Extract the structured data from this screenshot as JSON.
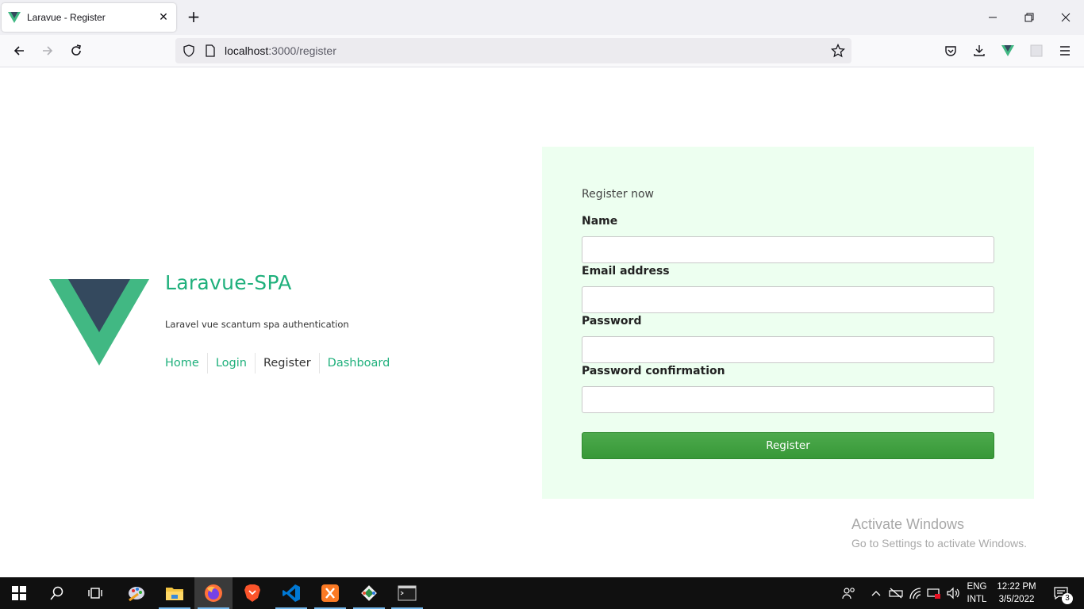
{
  "browser": {
    "tab_title": "Laravue - Register",
    "url_host": "localhost",
    "url_path": ":3000/register"
  },
  "brand": {
    "title": "Laravue-SPA",
    "subtitle": "Laravel vue scantum spa authentication",
    "colors": {
      "accent": "#1fb07c",
      "logo_light": "#41b883",
      "logo_dark": "#34495e"
    }
  },
  "menu": [
    {
      "label": "Home"
    },
    {
      "label": "Login"
    },
    {
      "label": "Register",
      "active": true
    },
    {
      "label": "Dashboard"
    }
  ],
  "form": {
    "heading": "Register now",
    "fields": [
      {
        "label": "Name",
        "value": ""
      },
      {
        "label": "Email address",
        "value": ""
      },
      {
        "label": "Password",
        "value": ""
      },
      {
        "label": "Password confirmation",
        "value": ""
      }
    ],
    "submit_label": "Register",
    "panel_color": "#edfff0",
    "button_color": "#3fa23f"
  },
  "watermark": {
    "title": "Activate Windows",
    "subtitle": "Go to Settings to activate Windows."
  },
  "taskbar": {
    "apps": [
      "start-icon",
      "search-icon",
      "task-view-icon",
      "paint-icon",
      "file-explorer-icon",
      "firefox-icon",
      "brave-icon",
      "vscode-icon",
      "xampp-icon",
      "git-icon",
      "terminal-icon"
    ],
    "lang_top": "ENG",
    "lang_bottom": "INTL",
    "time": "12:22 PM",
    "date": "3/5/2022",
    "notifications": "3"
  }
}
